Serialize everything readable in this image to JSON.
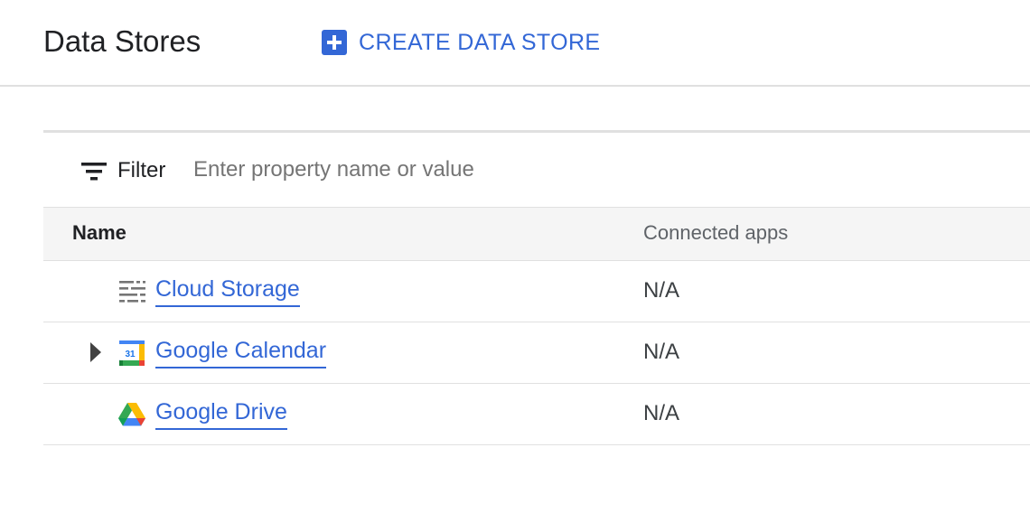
{
  "header": {
    "title": "Data Stores",
    "create_label": "CREATE DATA STORE"
  },
  "filter": {
    "label": "Filter",
    "placeholder": "Enter property name or value"
  },
  "table": {
    "columns": [
      "Name",
      "Connected apps"
    ],
    "rows": [
      {
        "name": "Cloud Storage",
        "connected_apps": "N/A",
        "icon": "cloud-storage-icon",
        "expandable": false
      },
      {
        "name": "Google Calendar",
        "connected_apps": "N/A",
        "icon": "google-calendar-icon",
        "expandable": true
      },
      {
        "name": "Google Drive",
        "connected_apps": "N/A",
        "icon": "google-drive-icon",
        "expandable": false
      }
    ]
  },
  "colors": {
    "accent": "#3367d6",
    "divider": "#e0e0e0",
    "header_bg": "#f5f5f5"
  }
}
